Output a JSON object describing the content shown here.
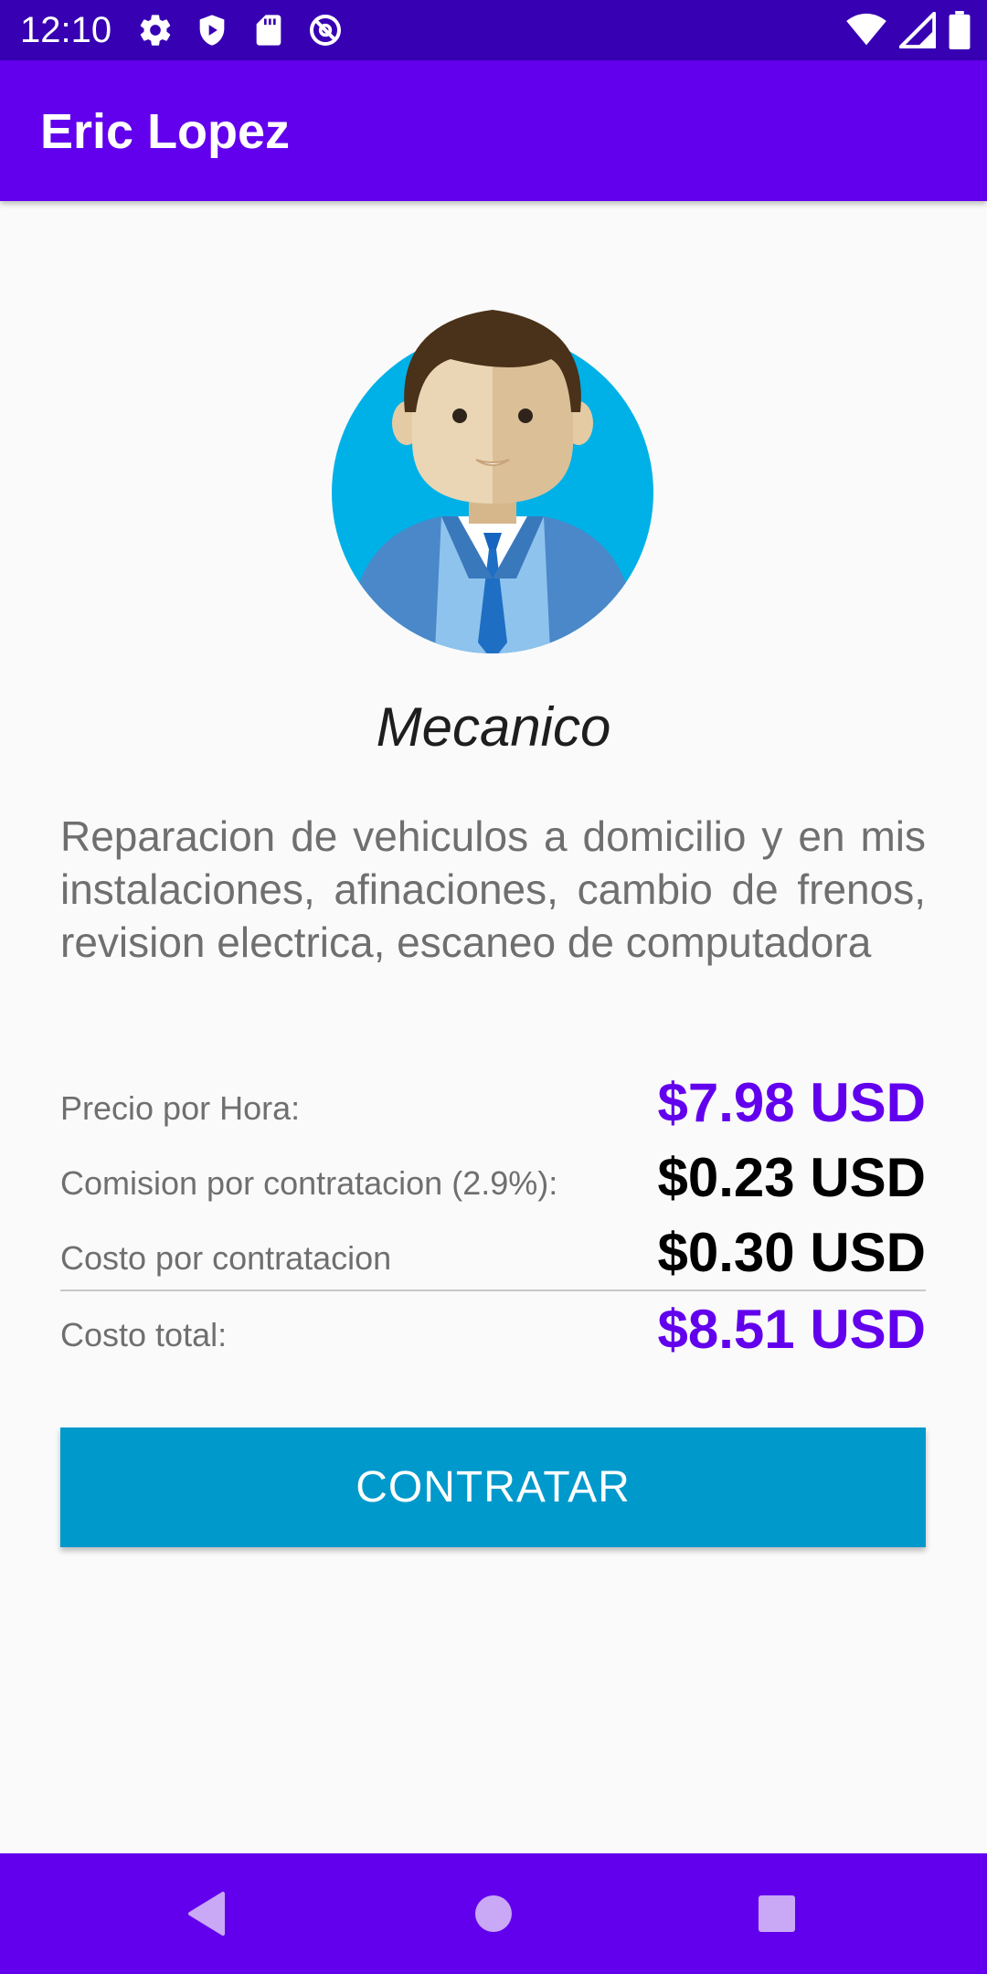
{
  "status_bar": {
    "time": "12:10",
    "left_icons": [
      "gear-icon",
      "shield-icon",
      "sd-card-icon",
      "no-disturb-icon"
    ],
    "right_icons": [
      "wifi-icon",
      "signal-icon",
      "battery-icon"
    ]
  },
  "app_bar": {
    "title": "Eric Lopez"
  },
  "profile": {
    "avatar": "businessman-avatar-icon",
    "profession": "Mecanico",
    "description": "Reparacion de vehiculos a domicilio y en mis instalaciones, afinaciones, cambio de frenos, revision electrica, escaneo de computadora"
  },
  "pricing": {
    "rows": [
      {
        "label": "Precio por Hora:",
        "value": "$7.98 USD"
      },
      {
        "label": "Comision por contratacion (2.9%):",
        "value": "$0.23 USD"
      },
      {
        "label": "Costo por contratacion",
        "value": "$0.30 USD"
      },
      {
        "label": "Costo total:",
        "value": "$8.51 USD"
      }
    ]
  },
  "actions": {
    "hire_label": "CONTRATAR"
  },
  "nav_bar": {
    "icons": [
      "back-icon",
      "home-icon",
      "recents-icon"
    ]
  },
  "colors": {
    "status_bar": "#3700b3",
    "primary": "#6200ee",
    "button": "#0099cc",
    "background": "#fafafa"
  }
}
